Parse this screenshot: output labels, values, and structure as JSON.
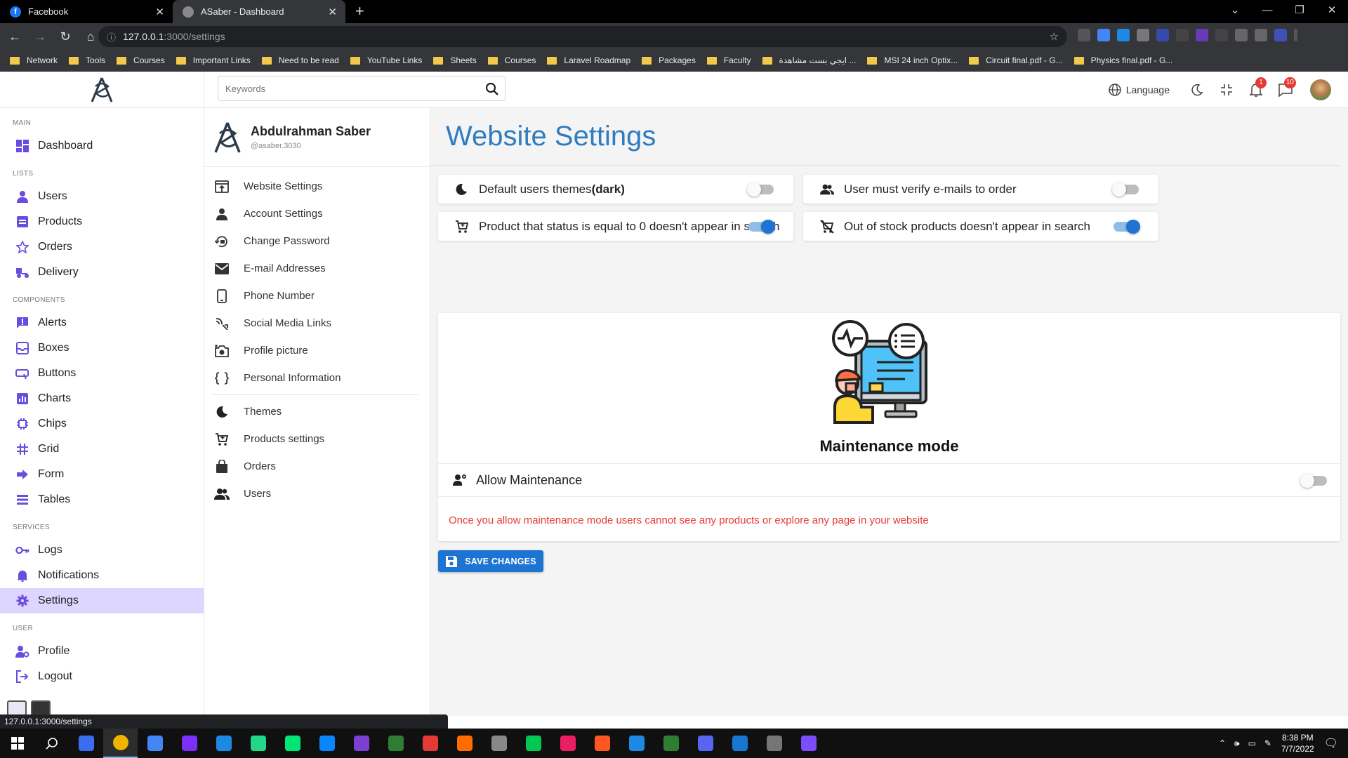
{
  "browser": {
    "tabs": [
      {
        "title": "Facebook",
        "favicon_color": "#1877f2",
        "favicon_letter": "f",
        "active": false
      },
      {
        "title": "ASaber - Dashboard",
        "favicon_color": "#8a8a8a",
        "favicon_letter": "",
        "active": true
      }
    ],
    "url_host": "127.0.0.1",
    "url_path": ":3000/settings",
    "bookmarks": [
      "Network",
      "Tools",
      "Courses",
      "Important Links",
      "Need to be read",
      "YouTube Links",
      "Sheets",
      "Courses",
      "Laravel Roadmap",
      "Packages",
      "Faculty",
      "ايجي بست مشاهدة ...",
      "MSI 24 inch Optix...",
      "Circuit final.pdf - G...",
      "Physics final.pdf - G..."
    ],
    "status_url": "127.0.0.1:3000/settings"
  },
  "sidebar": {
    "sections": [
      {
        "title": "MAIN",
        "items": [
          {
            "label": "Dashboard",
            "icon": "dashboard-icon"
          }
        ]
      },
      {
        "title": "LISTS",
        "items": [
          {
            "label": "Users",
            "icon": "user-icon"
          },
          {
            "label": "Products",
            "icon": "products-icon"
          },
          {
            "label": "Orders",
            "icon": "star-icon"
          },
          {
            "label": "Delivery",
            "icon": "delivery-icon"
          }
        ]
      },
      {
        "title": "COMPONENTS",
        "items": [
          {
            "label": "Alerts",
            "icon": "alert-icon"
          },
          {
            "label": "Boxes",
            "icon": "box-icon"
          },
          {
            "label": "Buttons",
            "icon": "button-icon"
          },
          {
            "label": "Charts",
            "icon": "chart-icon"
          },
          {
            "label": "Chips",
            "icon": "chip-icon"
          },
          {
            "label": "Grid",
            "icon": "grid-icon"
          },
          {
            "label": "Form",
            "icon": "arrow-right-icon"
          },
          {
            "label": "Tables",
            "icon": "table-icon"
          }
        ]
      },
      {
        "title": "SERVICES",
        "items": [
          {
            "label": "Logs",
            "icon": "key-icon"
          },
          {
            "label": "Notifications",
            "icon": "bell-icon"
          },
          {
            "label": "Settings",
            "icon": "gear-icon",
            "active": true
          }
        ]
      },
      {
        "title": "USER",
        "items": [
          {
            "label": "Profile",
            "icon": "profile-icon"
          },
          {
            "label": "Logout",
            "icon": "logout-icon"
          }
        ]
      }
    ]
  },
  "topbar": {
    "search_placeholder": "Keywords",
    "language_label": "Language",
    "notifications_count": "1",
    "messages_count": "10"
  },
  "profile": {
    "name": "Abdulrahman Saber",
    "username": "@asaber.3030"
  },
  "settings_nav": {
    "group1": [
      {
        "label": "Website Settings",
        "icon": "website-settings-icon"
      },
      {
        "label": "Account Settings",
        "icon": "account-icon"
      },
      {
        "label": "Change Password",
        "icon": "lock-reset-icon"
      },
      {
        "label": "E-mail Addresses",
        "icon": "mail-icon"
      },
      {
        "label": "Phone Number",
        "icon": "phone-icon"
      },
      {
        "label": "Social Media Links",
        "icon": "share-icon"
      },
      {
        "label": "Profile picture",
        "icon": "camera-icon"
      },
      {
        "label": "Personal Information",
        "icon": "braces-icon"
      }
    ],
    "group2": [
      {
        "label": "Themes",
        "icon": "moon-icon"
      },
      {
        "label": "Products settings",
        "icon": "cart-icon"
      },
      {
        "label": "Orders",
        "icon": "bag-icon"
      },
      {
        "label": "Users",
        "icon": "users-icon"
      }
    ]
  },
  "main": {
    "title": "Website Settings",
    "options": [
      {
        "label": "Default users themes",
        "label_bold": "(dark)",
        "icon": "moon-icon",
        "enabled": false
      },
      {
        "label": "User must verify e-mails to order",
        "label_bold": "",
        "icon": "users-icon",
        "enabled": false
      },
      {
        "label": "Product that status is equal to 0 doesn't appear in search",
        "label_bold": "",
        "icon": "cart-icon",
        "enabled": true
      },
      {
        "label": "Out of stock products doesn't appear in search",
        "label_bold": "",
        "icon": "cart-off-icon",
        "enabled": true
      }
    ],
    "maintenance": {
      "title": "Maintenance mode",
      "toggle_label": "Allow Maintenance",
      "enabled": false,
      "note": "Once you allow maintenance mode users cannot see any products or explore any page in your website"
    },
    "save_label": "SAVE CHANGES"
  },
  "taskbar": {
    "time": "8:38 PM",
    "date": "7/7/2022",
    "apps": [
      "#3a6df0",
      "#f0b400",
      "#4285f4",
      "#7b2ff7",
      "#1e88e5",
      "#21d789",
      "#00e676",
      "#0a84ff",
      "#7b3fd3",
      "#2e7d32",
      "#e53935",
      "#ff6d00",
      "#888888",
      "#00c853",
      "#e91e63",
      "#ff5722",
      "#1e88e5",
      "#2e7d32",
      "#5865f2",
      "#1976d2",
      "#757575",
      "#7c4dff"
    ]
  },
  "colors": {
    "accent": "#6a4cdf",
    "title_blue": "#2f7cc0",
    "save_blue": "#1e74d2",
    "warning_red": "#e53935",
    "sidebar_active": "#ddd6fe"
  }
}
